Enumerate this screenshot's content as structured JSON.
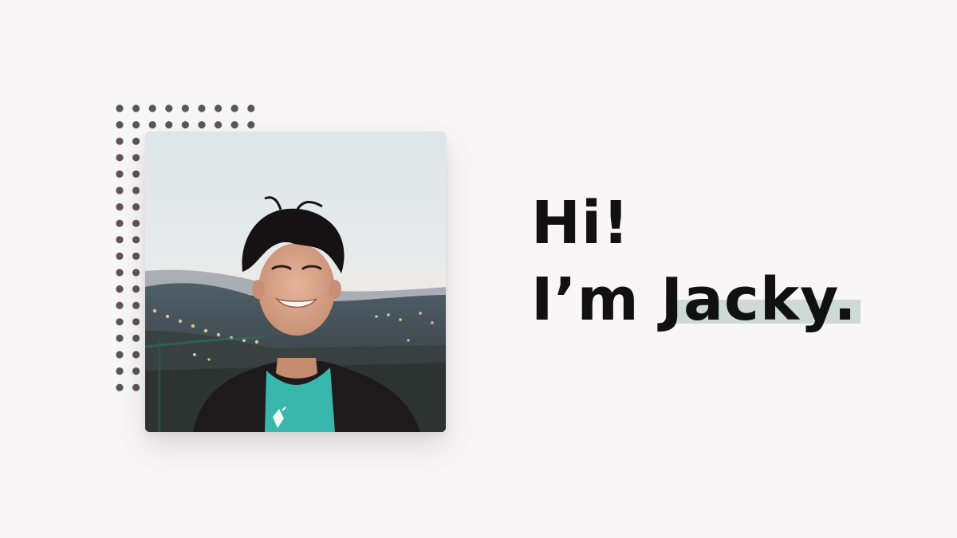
{
  "greeting": {
    "line1": "Hi!",
    "line2_prefix": "I’m ",
    "name": "Jacky."
  },
  "photo": {
    "subject": "portrait-photo",
    "colors": {
      "sky_top": "#dfe7ea",
      "sky_bottom": "#f1ece8",
      "shirt": "#39b7ac",
      "jacket": "#1d1a1c",
      "hair": "#161214"
    }
  },
  "colors": {
    "background": "#f8f6f7",
    "text": "#111111",
    "name_highlight": "#cfdad6",
    "dots": "#5e5556"
  }
}
